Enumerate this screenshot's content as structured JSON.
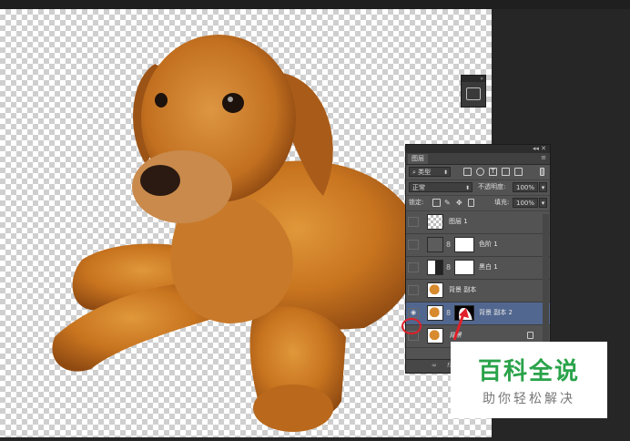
{
  "layers_panel": {
    "tab": "图层",
    "filter_kind": "类型",
    "blend_mode": "正常",
    "opacity_label": "不透明度:",
    "opacity_value": "100%",
    "lock_label": "锁定:",
    "fill_label": "填充:",
    "fill_value": "100%",
    "layers": [
      {
        "name": "图层 1",
        "visible": false
      },
      {
        "name": "色阶 1",
        "visible": false
      },
      {
        "name": "黑白 1",
        "visible": false
      },
      {
        "name": "背景 副本",
        "visible": false
      },
      {
        "name": "背景 副本 2",
        "visible": true,
        "selected": true
      },
      {
        "name": "背景",
        "visible": false,
        "locked": true
      }
    ],
    "footer_fx": "fx"
  },
  "watermark": {
    "title": "百科全说",
    "subtitle": "助你轻松解决"
  },
  "colors": {
    "selected_layer": "#51678f",
    "annotation_red": "#e0202a",
    "watermark_green": "#2aa34a"
  }
}
